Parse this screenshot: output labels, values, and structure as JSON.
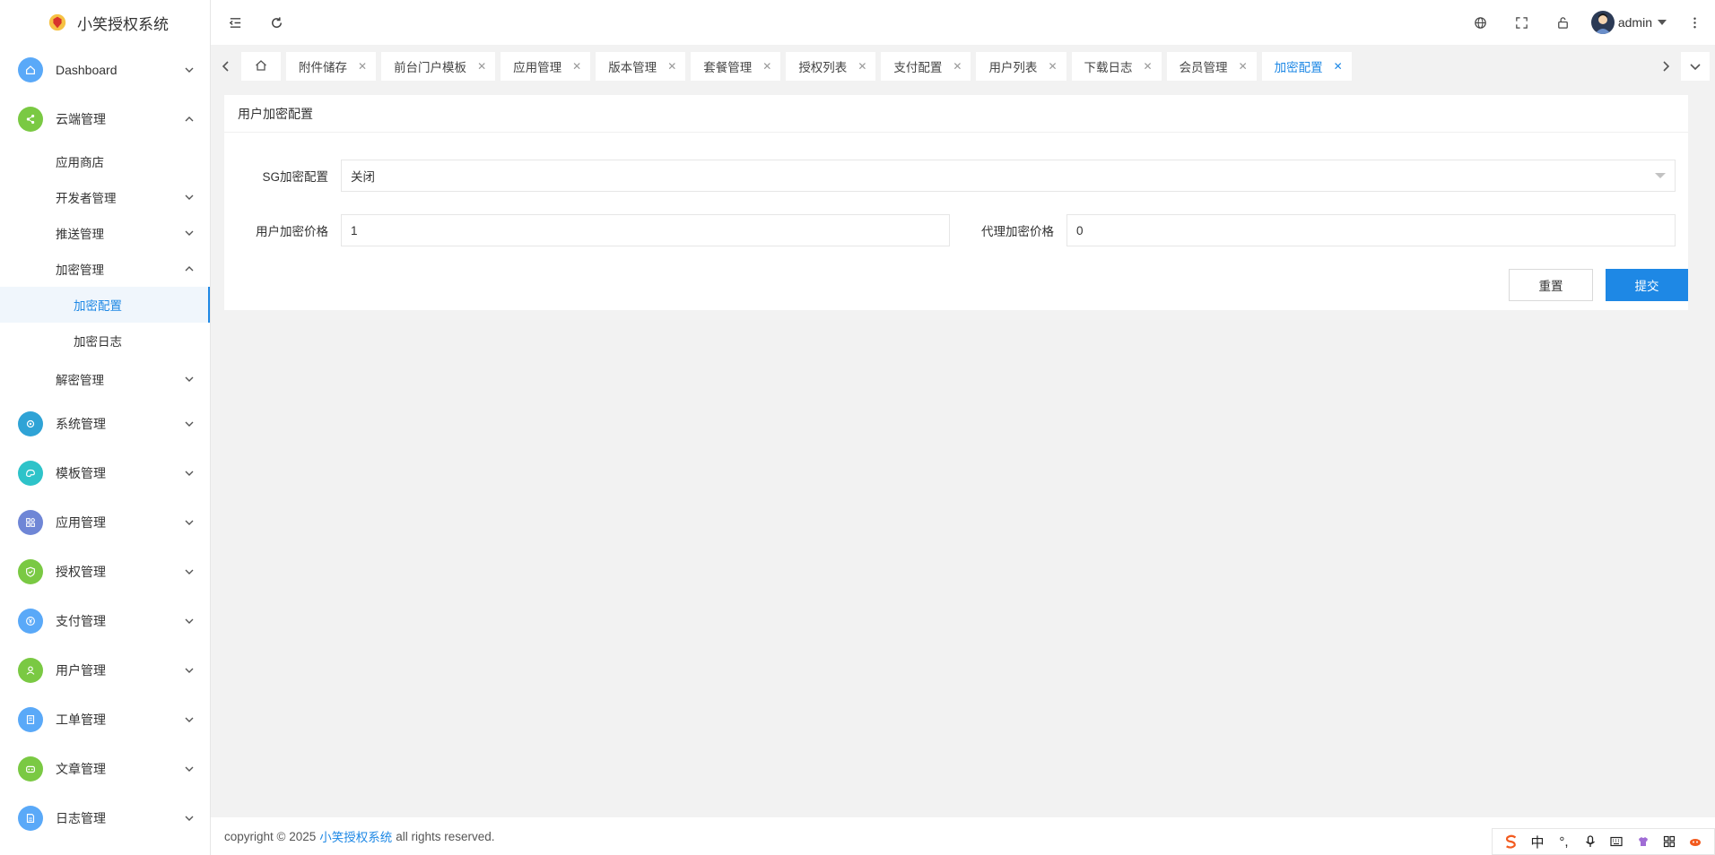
{
  "app": {
    "title": "小笑授权系统"
  },
  "sidebar": {
    "items": [
      {
        "label": "Dashboard",
        "icon": "home-icon",
        "color": "#5aa9f8"
      },
      {
        "label": "云端管理",
        "icon": "share-icon",
        "color": "#7ac943"
      },
      {
        "label": "系统管理",
        "icon": "gear-icon",
        "color": "#2fa3d6"
      },
      {
        "label": "模板管理",
        "icon": "palette-icon",
        "color": "#2ec3c9"
      },
      {
        "label": "应用管理",
        "icon": "apps-icon",
        "color": "#6f86d6"
      },
      {
        "label": "授权管理",
        "icon": "shield-icon",
        "color": "#7ac943"
      },
      {
        "label": "支付管理",
        "icon": "yen-icon",
        "color": "#5aa9f8"
      },
      {
        "label": "用户管理",
        "icon": "user-icon",
        "color": "#7ac943"
      },
      {
        "label": "工单管理",
        "icon": "ticket-icon",
        "color": "#5aa9f8"
      },
      {
        "label": "文章管理",
        "icon": "article-icon",
        "color": "#7ac943"
      },
      {
        "label": "日志管理",
        "icon": "log-icon",
        "color": "#5aa9f8"
      }
    ],
    "cloud_sub": [
      {
        "label": "应用商店"
      },
      {
        "label": "开发者管理"
      },
      {
        "label": "推送管理"
      },
      {
        "label": "加密管理"
      },
      {
        "label": "解密管理"
      }
    ],
    "encrypt_sub": [
      {
        "label": "加密配置",
        "active": true
      },
      {
        "label": "加密日志"
      }
    ]
  },
  "header": {
    "user": "admin"
  },
  "tabs": [
    {
      "label": "附件储存"
    },
    {
      "label": "前台门户模板"
    },
    {
      "label": "应用管理"
    },
    {
      "label": "版本管理"
    },
    {
      "label": "套餐管理"
    },
    {
      "label": "授权列表"
    },
    {
      "label": "支付配置"
    },
    {
      "label": "用户列表"
    },
    {
      "label": "下载日志"
    },
    {
      "label": "会员管理"
    },
    {
      "label": "加密配置",
      "active": true
    }
  ],
  "card": {
    "title": "用户加密配置",
    "sg_label": "SG加密配置",
    "sg_value": "关闭",
    "user_price_label": "用户加密价格",
    "user_price_value": "1",
    "agent_price_label": "代理加密价格",
    "agent_price_value": "0",
    "reset_label": "重置",
    "submit_label": "提交"
  },
  "footer": {
    "prefix": "copyright © 2025",
    "link": "小笑授权系统",
    "suffix": "all rights reserved."
  },
  "ime": {
    "chinese_label": "中"
  },
  "colors": {
    "accent": "#1e88e5"
  }
}
